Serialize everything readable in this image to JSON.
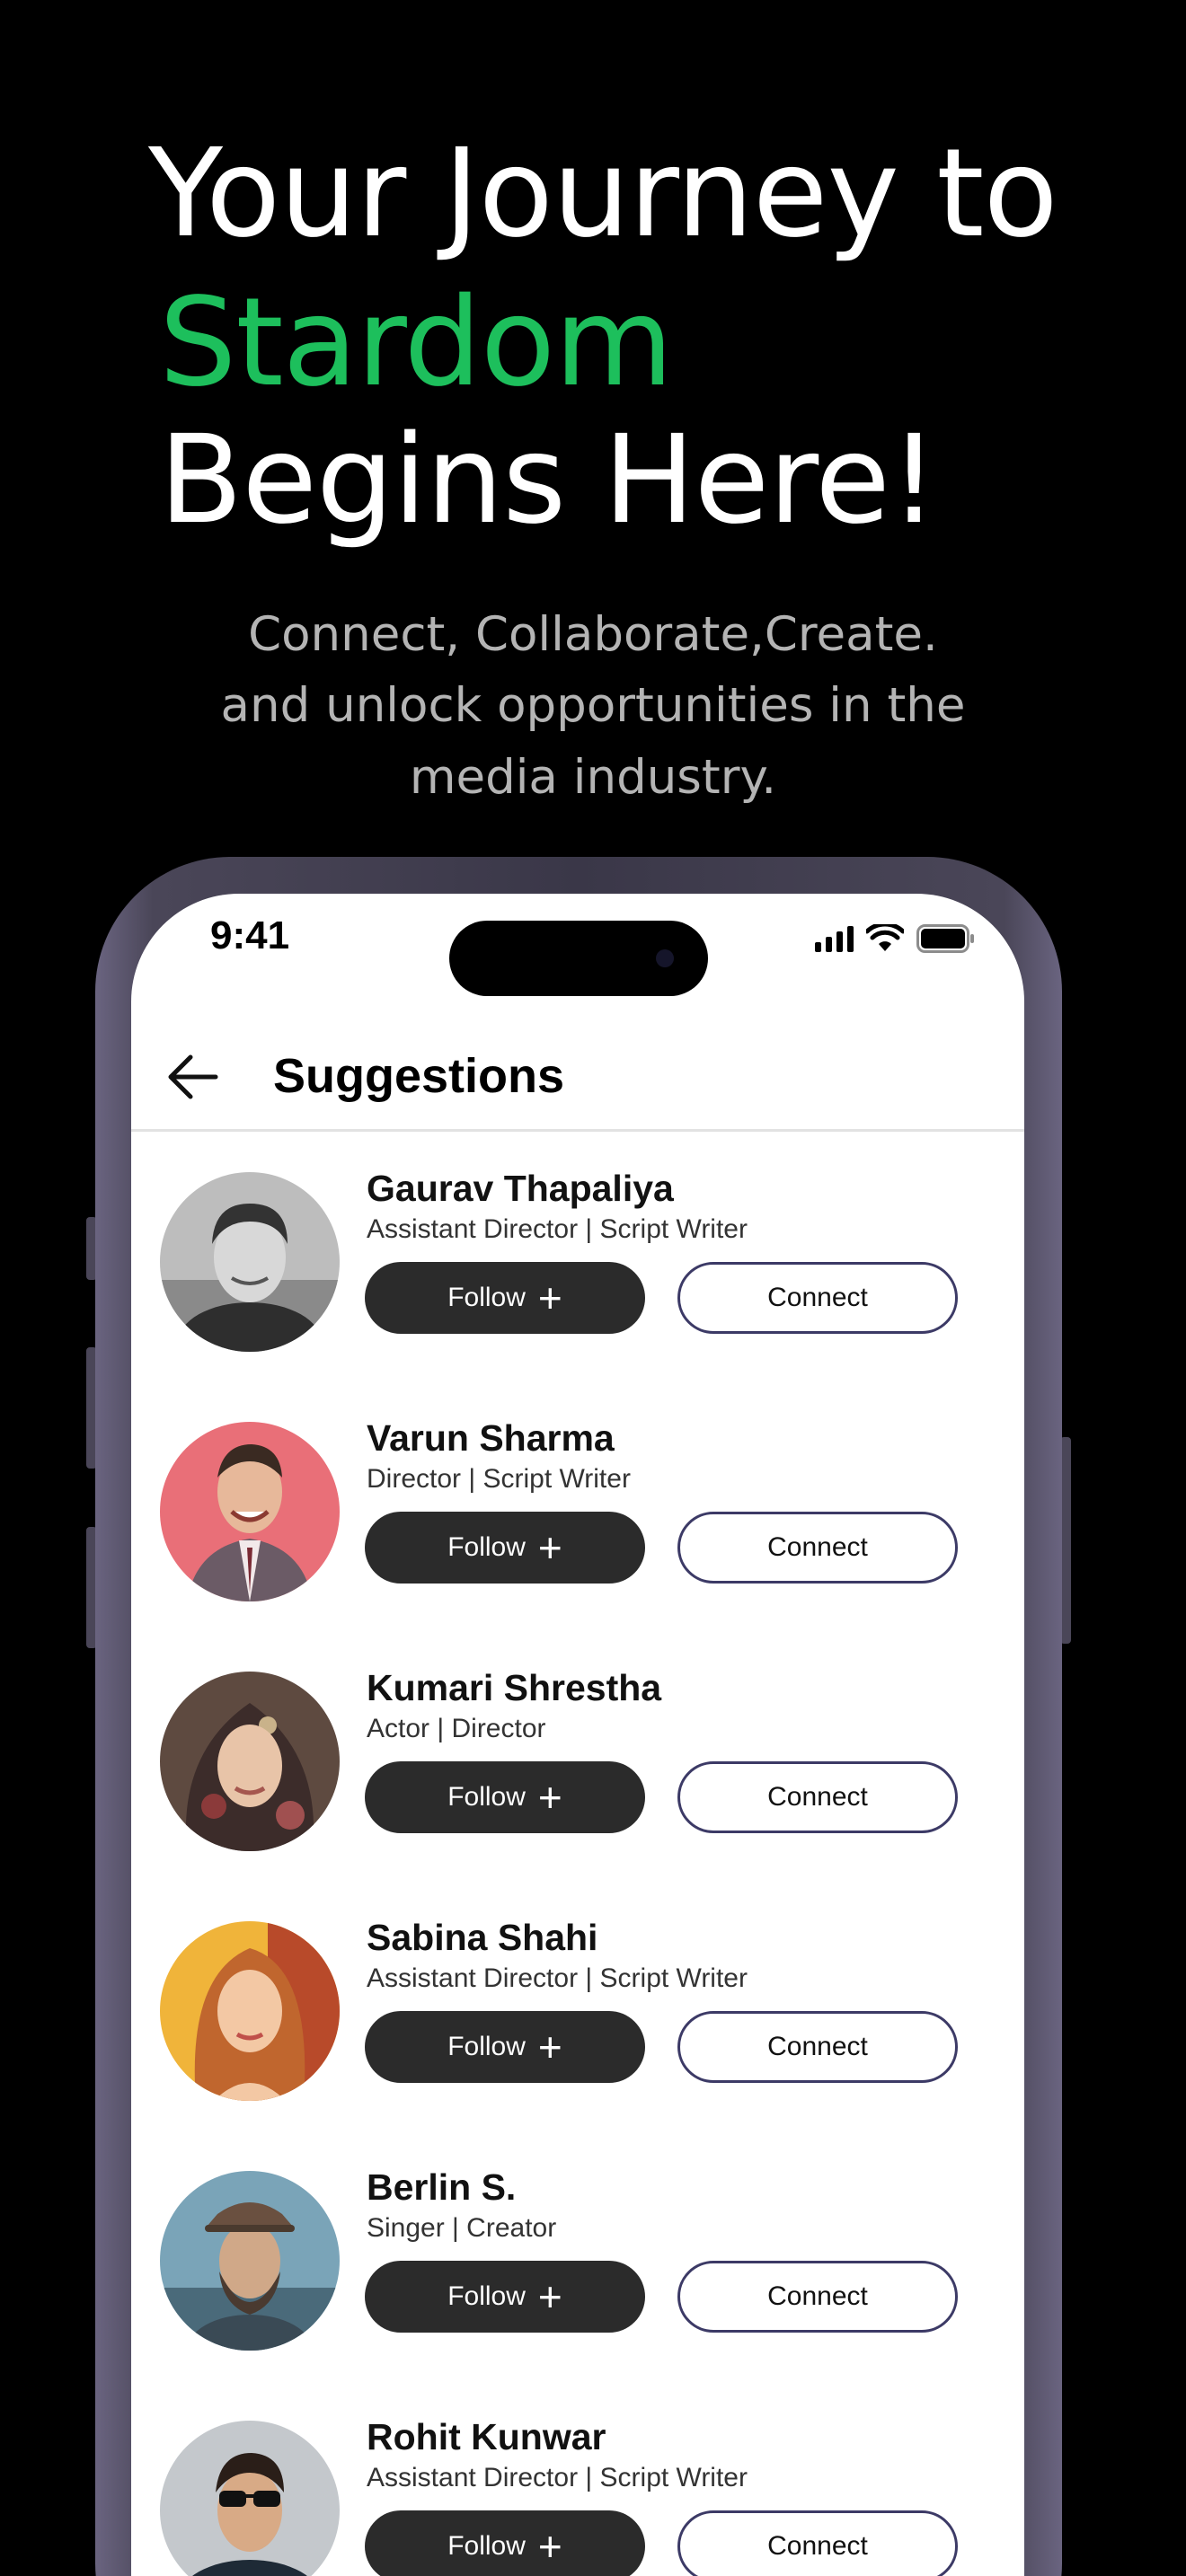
{
  "hero": {
    "line1": "Your Journey to",
    "line2": "Stardom",
    "line3": "Begins Here!",
    "accent_color": "#1dbf5c"
  },
  "subtitle": {
    "line1": "Connect, Collaborate,Create.",
    "line2": "and unlock opportunities in the",
    "line3": "media industry."
  },
  "status_bar": {
    "time": "9:41",
    "icons": [
      "signal-icon",
      "wifi-icon",
      "battery-icon"
    ]
  },
  "header": {
    "title": "Suggestions",
    "back_icon": "arrow-left-icon"
  },
  "suggestions": [
    {
      "name": "Gaurav Thapaliya",
      "role": "Assistant Director | Script Writer",
      "follow_label": "Follow",
      "connect_label": "Connect"
    },
    {
      "name": "Varun Sharma",
      "role": "Director | Script Writer",
      "follow_label": "Follow",
      "connect_label": "Connect"
    },
    {
      "name": "Kumari Shrestha",
      "role": "Actor | Director",
      "follow_label": "Follow",
      "connect_label": "Connect"
    },
    {
      "name": "Sabina Shahi",
      "role": "Assistant Director | Script Writer",
      "follow_label": "Follow",
      "connect_label": "Connect"
    },
    {
      "name": "Berlin S.",
      "role": "Singer | Creator",
      "follow_label": "Follow",
      "connect_label": "Connect"
    },
    {
      "name": "Rohit Kunwar",
      "role": "Assistant Director | Script Writer",
      "follow_label": "Follow",
      "connect_label": "Connect"
    }
  ]
}
